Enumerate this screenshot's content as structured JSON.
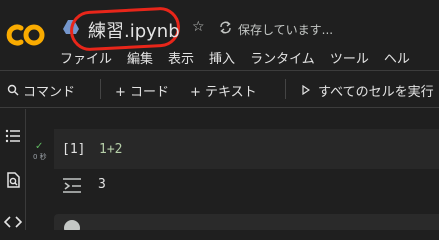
{
  "header": {
    "title": "練習.ipynb",
    "save_status": "保存しています...",
    "star_glyph": "☆"
  },
  "menu": [
    "ファイル",
    "編集",
    "表示",
    "挿入",
    "ランタイム",
    "ツール",
    "ヘル"
  ],
  "toolbar": {
    "command_label": "コマンド",
    "add_code_label": "+ コード",
    "add_text_label": "+ テキスト",
    "run_all_label": "すべてのセルを実行"
  },
  "cell": {
    "exec_count": "[1]",
    "code": "1+2",
    "run_time": "0 秒",
    "run_status_glyph": "✓",
    "output": "3"
  },
  "colors": {
    "background": "#1f1f1f",
    "cell_background": "#282828",
    "annotation_red": "#e8261a",
    "logo_orange": "#f9ab00",
    "success_green": "#5fb760"
  }
}
